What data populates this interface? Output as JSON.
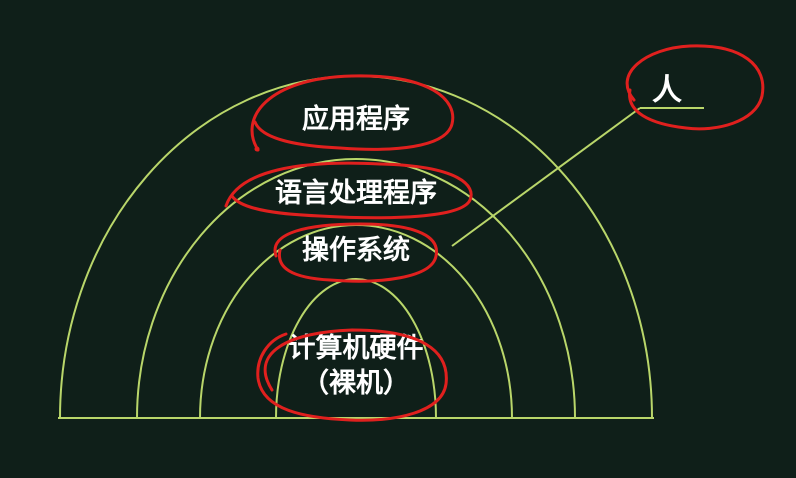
{
  "diagram": {
    "layers": [
      {
        "id": "application",
        "label": "应用程序"
      },
      {
        "id": "language-processor",
        "label": "语言处理程序"
      },
      {
        "id": "operating-system",
        "label": "操作系统"
      },
      {
        "id": "hardware",
        "label_line1": "计算机硬件",
        "label_line2": "（裸机）"
      }
    ],
    "user_label": "人",
    "colors": {
      "background": "#0f1f19",
      "arc": "#b9d66a",
      "annotation": "#e0201e",
      "text": "#ffffff"
    }
  }
}
